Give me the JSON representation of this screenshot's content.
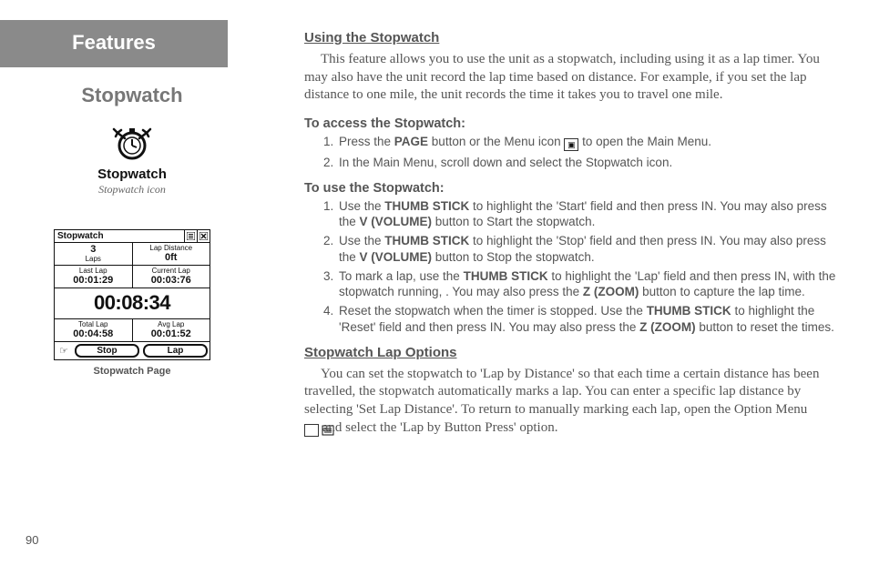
{
  "page_number": "90",
  "left": {
    "features_label": "Features",
    "section_title": "Stopwatch",
    "icon_word": "Stopwatch",
    "icon_caption": "Stopwatch icon",
    "screen_caption": "Stopwatch Page"
  },
  "screen": {
    "title": "Stopwatch",
    "laps_label": "Laps",
    "laps_value": "3",
    "lapdist_label": "Lap Distance",
    "lapdist_value": "0ft",
    "lastlap_label": "Last Lap",
    "lastlap_value": "00:01:29",
    "currlap_label": "Current Lap",
    "currlap_value": "00:03:76",
    "main_time": "00:08:34",
    "totlap_label": "Total Lap",
    "totlap_value": "00:04:58",
    "avglap_label": "Avg Lap",
    "avglap_value": "00:01:52",
    "btn_stop": "Stop",
    "btn_lap": "Lap"
  },
  "right": {
    "h1": "Using the Stopwatch",
    "p1": "This feature allows you to use the unit as a stopwatch, including using it as a lap timer.  You may also have the unit record the lap time based on distance.  For example, if you set the lap distance to one mile, the unit records the time it takes you to travel one mile.",
    "sub1": "To access the Stopwatch:",
    "li1a_pre": "Press the ",
    "li1a_b": "PAGE",
    "li1a_mid": " button or the Menu icon ",
    "li1a_post": " to open the Main Menu.",
    "li1b": "In the Main Menu, scroll down and select the Stopwatch icon.",
    "sub2": "To use the Stopwatch:",
    "li2_1_a": "Use the ",
    "li2_1_b": "THUMB STICK",
    "li2_1_c": " to highlight the 'Start' field and then press IN.  You may also press the ",
    "li2_1_d": "V (VOLUME)",
    "li2_1_e": " button to Start the stopwatch.",
    "li2_2_a": "Use the ",
    "li2_2_b": "THUMB STICK",
    "li2_2_c": " to highlight the 'Stop' field and then press IN.  You may also press the ",
    "li2_2_d": "V (VOLUME)",
    "li2_2_e": " button to Stop the stopwatch.",
    "li2_3_a": "To mark a lap, use the ",
    "li2_3_b": "THUMB STICK",
    "li2_3_c": " to highlight the 'Lap' field and then press IN, with the stopwatch running, .  You may also press the ",
    "li2_3_d": "Z (ZOOM)",
    "li2_3_e": " button to capture the lap time.",
    "li2_4_a": "Reset the stopwatch when the timer is stopped.  Use the ",
    "li2_4_b": "THUMB STICK",
    "li2_4_c": " to highlight the 'Reset' field and then press IN.  You may also press the ",
    "li2_4_d": "Z (ZOOM)",
    "li2_4_e": " button to reset the times.",
    "h2": "Stopwatch Lap Options",
    "p2a": "You can set the stopwatch to 'Lap by Distance' so that each time a certain distance has been travelled, the stopwatch automatically marks a lap.  You can enter a specific lap distance by selecting 'Set Lap Distance'.  To return to manually marking each lap, open the Option Menu ",
    "p2b": " and select the 'Lap by Button Press' option."
  }
}
